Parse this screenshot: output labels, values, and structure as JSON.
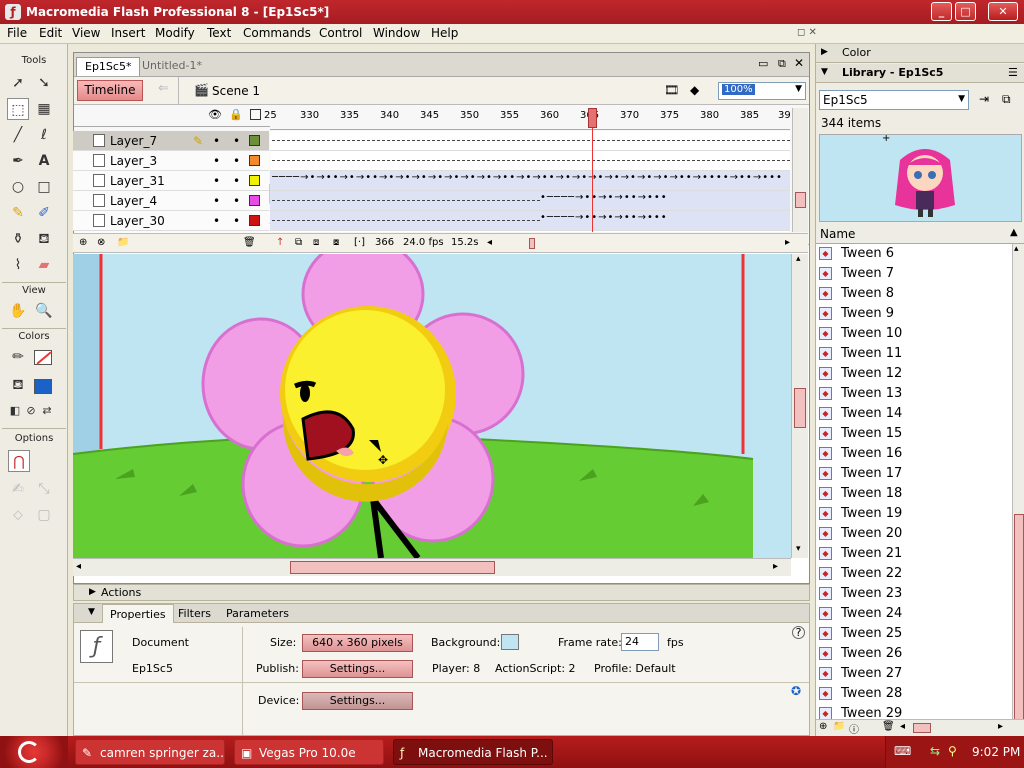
{
  "title": "Macromedia Flash Professional 8 - [Ep1Sc5*]",
  "menu": [
    "File",
    "Edit",
    "View",
    "Insert",
    "Modify",
    "Text",
    "Commands",
    "Control",
    "Window",
    "Help"
  ],
  "tools": {
    "header": "Tools",
    "view_header": "View",
    "colors_header": "Colors",
    "options_header": "Options"
  },
  "doc": {
    "tabs": [
      {
        "label": "Ep1Sc5*",
        "active": true
      },
      {
        "label": "Untitled-1*",
        "active": false
      }
    ],
    "timeline_button": "Timeline",
    "scene": "Scene 1",
    "zoom": "100%"
  },
  "timeline": {
    "layers": [
      {
        "name": "Layer_7",
        "color": "#6b8f3a",
        "selected": true
      },
      {
        "name": "Layer_3",
        "color": "#f28a2c",
        "selected": false
      },
      {
        "name": "Layer_31",
        "color": "#f2f200",
        "selected": false
      },
      {
        "name": "Layer_4",
        "color": "#e64be6",
        "selected": false
      },
      {
        "name": "Layer_30",
        "color": "#cc1414",
        "selected": false
      }
    ],
    "ruler": [
      "25",
      "330",
      "335",
      "340",
      "345",
      "350",
      "355",
      "360",
      "365",
      "370",
      "375",
      "380",
      "385",
      "39"
    ],
    "current_frame": "366",
    "fps": "24.0 fps",
    "time": "15.2s",
    "current_frame_marker": 365
  },
  "actions_label": "Actions",
  "properties": {
    "tabs": [
      "Properties",
      "Filters",
      "Parameters"
    ],
    "doc_type": "Document",
    "doc_name": "Ep1Sc5",
    "size_label": "Size:",
    "size_value": "640 x 360 pixels",
    "background_label": "Background:",
    "framerate_label": "Frame rate:",
    "framerate_value": "24",
    "fps_unit": "fps",
    "publish_label": "Publish:",
    "settings_label": "Settings...",
    "player": "Player: 8",
    "actionscript": "ActionScript:  2",
    "profile": "Profile:  Default",
    "device_label": "Device:",
    "device_settings": "Settings..."
  },
  "color_panel": "Color",
  "library": {
    "header": "Library - Ep1Sc5",
    "selected": "Ep1Sc5",
    "count": "344 items",
    "col_name": "Name",
    "items": [
      "Tween 6",
      "Tween 7",
      "Tween 8",
      "Tween 9",
      "Tween 10",
      "Tween 11",
      "Tween 12",
      "Tween 13",
      "Tween 14",
      "Tween 15",
      "Tween 16",
      "Tween 17",
      "Tween 18",
      "Tween 19",
      "Tween 20",
      "Tween 21",
      "Tween 22",
      "Tween 23",
      "Tween 24",
      "Tween 25",
      "Tween 26",
      "Tween 27",
      "Tween 28",
      "Tween 29"
    ]
  },
  "taskbar": {
    "tasks": [
      {
        "label": "camren springer za...",
        "active": false
      },
      {
        "label": "Vegas Pro 10.0e",
        "active": false
      },
      {
        "label": "Macromedia Flash P...",
        "active": true
      }
    ],
    "clock": "9:02 PM"
  },
  "colors": {
    "titlebar": "#b71c1c",
    "stage_sky": "#bfe4f2",
    "grass": "#66cc33",
    "petal": "#f29ee6",
    "flower_center": "#f7e21b"
  },
  "icons": [
    "pencil-icon",
    "arrow-icon",
    "lasso-icon",
    "pen-icon",
    "text-icon",
    "oval-icon",
    "rectangle-icon",
    "brush-icon",
    "ink-bottle-icon",
    "paint-bucket-icon",
    "eyedropper-icon",
    "eraser-icon",
    "hand-icon",
    "zoom-icon"
  ]
}
